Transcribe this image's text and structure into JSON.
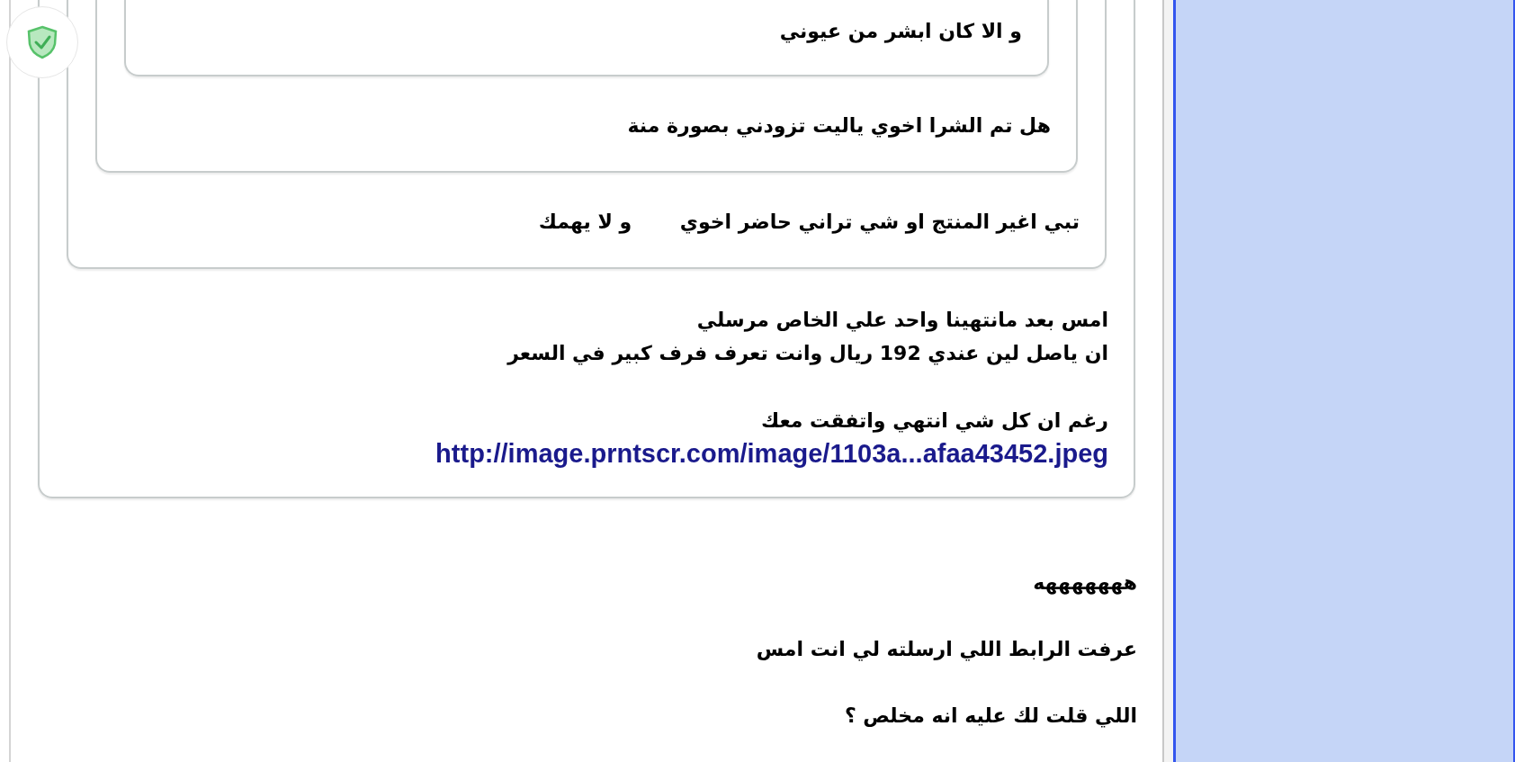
{
  "badge": {
    "kind": "shield"
  },
  "post": {
    "quote": {
      "text": "تبي اغير المنتج او شي تراني حاضر اخوي       و لا يهمك",
      "quote": {
        "text": "هل تم الشرا اخوي ياليت تزودني بصورة منة",
        "quote": {
          "text": "و الا كان ابشر من عيوني"
        }
      }
    },
    "paragraphs": [
      [
        {
          "kind": "text",
          "text": "امس بعد مانتهينا واحد علي الخاص مرسلي"
        },
        {
          "kind": "text",
          "text": "ان ياصل لين عندي 192 ريال وانت تعرف فرف كبير في السعر"
        }
      ],
      [
        {
          "kind": "text",
          "text": "رغم ان كل شي انتهي واتفقت معك"
        },
        {
          "kind": "link",
          "text": "http://image.prntscr.com/image/1103a...afaa43452.jpeg"
        }
      ]
    ]
  },
  "replies": [
    "هههههههه",
    "عرفت الرابط اللي ارسلته لي انت امس",
    "اللي قلت لك عليه انه مخلص ؟"
  ]
}
